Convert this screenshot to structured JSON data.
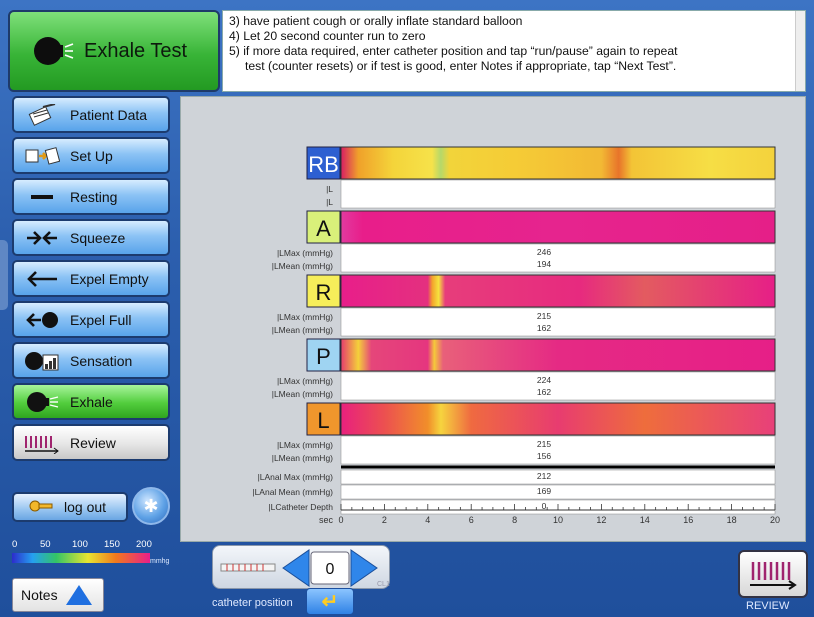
{
  "header": {
    "test_label": "Exhale Test",
    "instructions": [
      "3) have patient cough or orally inflate standard balloon",
      "4) Let 20 second counter run to zero",
      "5) if more data required, enter catheter position and tap “run/pause” again to repeat",
      "test (counter resets) or if test is good, enter Notes if appropriate, tap “Next Test”."
    ]
  },
  "nav": [
    {
      "label": "Patient Data",
      "icon": "patient-data-icon"
    },
    {
      "label": "Set Up",
      "icon": "setup-icon"
    },
    {
      "label": "Resting",
      "icon": "resting-icon"
    },
    {
      "label": "Squeeze",
      "icon": "squeeze-icon"
    },
    {
      "label": "Expel Empty",
      "icon": "expel-empty-icon"
    },
    {
      "label": "Expel Full",
      "icon": "expel-full-icon"
    },
    {
      "label": "Sensation",
      "icon": "sensation-icon"
    },
    {
      "label": "Exhale",
      "icon": "exhale-icon",
      "active": true
    },
    {
      "label": "Review",
      "icon": "review-icon"
    }
  ],
  "logout_label": "log out",
  "pressure_scale": {
    "ticks": [
      "0",
      "50",
      "100",
      "150",
      "200"
    ],
    "unit": "mmhg"
  },
  "notes_label": "Notes",
  "catheter": {
    "value": "0",
    "label": "catheter position",
    "small_tag": "CL1"
  },
  "review_label": "REVIEW",
  "chart": {
    "channels": [
      {
        "tag": "RB",
        "tag_color": "#2d5fd1",
        "tag_text_color": "#ffffff",
        "row_labels": [
          "|L",
          "|L"
        ],
        "values": [
          "",
          ""
        ]
      },
      {
        "tag": "A",
        "tag_color": "#d9f07a",
        "tag_text_color": "#111111",
        "row_labels": [
          "|LMax (mmHg)",
          "|LMean (mmHg)"
        ],
        "values": [
          "246",
          "194"
        ]
      },
      {
        "tag": "R",
        "tag_color": "#f6ee5a",
        "tag_text_color": "#111111",
        "row_labels": [
          "|LMax (mmHg)",
          "|LMean (mmHg)"
        ],
        "values": [
          "215",
          "162"
        ]
      },
      {
        "tag": "P",
        "tag_color": "#9fd4f2",
        "tag_text_color": "#111111",
        "row_labels": [
          "|LMax (mmHg)",
          "|LMean (mmHg)"
        ],
        "values": [
          "224",
          "162"
        ]
      },
      {
        "tag": "L",
        "tag_color": "#f0962c",
        "tag_text_color": "#111111",
        "row_labels": [
          "|LMax (mmHg)",
          "|LMean (mmHg)"
        ],
        "values": [
          "215",
          "156"
        ]
      }
    ],
    "anal_rows": [
      {
        "label": "|LAnal Max (mmHg)",
        "value": "212"
      },
      {
        "label": "|LAnal Mean (mmHg)",
        "value": "169"
      },
      {
        "label": "|LCatheter Depth",
        "value": "0"
      }
    ],
    "axis": {
      "label": "sec",
      "min": 0,
      "max": 20,
      "ticks": [
        "0",
        "2",
        "4",
        "6",
        "8",
        "10",
        "12",
        "14",
        "16",
        "18",
        "20"
      ]
    }
  }
}
